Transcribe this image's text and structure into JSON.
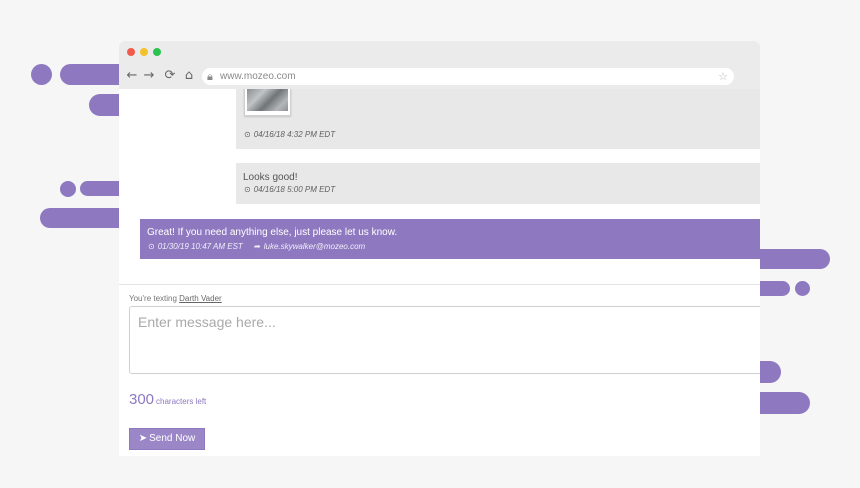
{
  "browser": {
    "url": "www.mozeo.com",
    "nav_icons": [
      "back-arrow-icon",
      "forward-arrow-icon",
      "reload-icon",
      "home-icon"
    ],
    "secure_icon": "lock-icon",
    "bookmark_icon": "star-icon"
  },
  "conversation": {
    "messages": [
      {
        "type": "incoming",
        "has_image": true,
        "timestamp": "04/16/18 4:32 PM EDT"
      },
      {
        "type": "incoming",
        "text": "Looks good!",
        "timestamp": "04/16/18 5:00 PM EDT"
      },
      {
        "type": "outgoing",
        "text": "Great! If you need anything else, just please let us know.",
        "timestamp": "01/30/19 10:47 AM EST",
        "sender": "luke.skywalker@mozeo.com"
      }
    ]
  },
  "compose": {
    "prefix": "You're texting ",
    "recipient": "Darth Vader",
    "placeholder": "Enter message here...",
    "chars_left": "300",
    "chars_left_label": "characters left",
    "send_label": "Send Now"
  },
  "colors": {
    "accent": "#8e79c0",
    "incoming_bubble": "#e8e8e8",
    "background": "#f6f6f6"
  }
}
